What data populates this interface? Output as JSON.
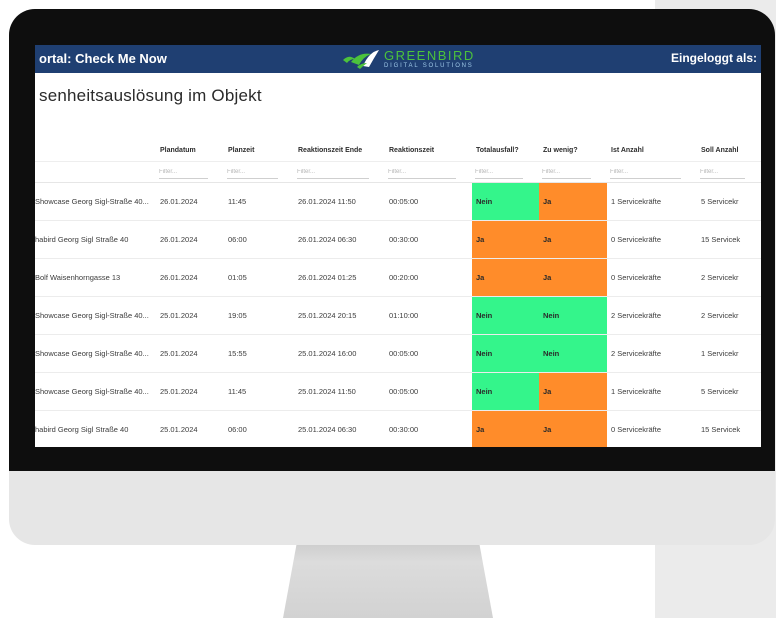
{
  "colors": {
    "appbar_bg": "#1f3f72",
    "status_yes": "#ff8c2a",
    "status_no": "#34f58b",
    "logo_green": "#4cc23c"
  },
  "appbar": {
    "title": "ortal: Check Me Now",
    "logo_line1": "GREENBIRD",
    "logo_line2": "DIGITAL SOLUTIONS",
    "logo_icon": "greenbird-logo-icon",
    "user": "Eingeloggt als:"
  },
  "page": {
    "title": "senheitsauslösung im Objekt"
  },
  "table": {
    "headers": [
      "",
      "Plandatum",
      "Planzeit",
      "Reaktionszeit Ende",
      "Reaktionszeit",
      "Totalausfall?",
      "Zu wenig?",
      "Ist Anzahl",
      "Soll Anzahl"
    ],
    "filter_placeholder": "Filter...",
    "rows": [
      [
        "Showcase Georg Sigl-Straße 40...",
        "26.01.2024",
        "11:45",
        "26.01.2024 11:50",
        "00:05:00",
        "Nein",
        "Ja",
        "1 Servicekräfte",
        "5 Servicekr"
      ],
      [
        "habird Georg Sigl Straße 40",
        "26.01.2024",
        "06:00",
        "26.01.2024 06:30",
        "00:30:00",
        "Ja",
        "Ja",
        "0 Servicekräfte",
        "15 Servicek"
      ],
      [
        "Bolf Waisenhorngasse 13",
        "26.01.2024",
        "01:05",
        "26.01.2024 01:25",
        "00:20:00",
        "Ja",
        "Ja",
        "0 Servicekräfte",
        "2 Servicekr"
      ],
      [
        "Showcase Georg Sigl-Straße 40...",
        "25.01.2024",
        "19:05",
        "25.01.2024 20:15",
        "01:10:00",
        "Nein",
        "Nein",
        "2 Servicekräfte",
        "2 Servicekr"
      ],
      [
        "Showcase Georg Sigl-Straße 40...",
        "25.01.2024",
        "15:55",
        "25.01.2024 16:00",
        "00:05:00",
        "Nein",
        "Nein",
        "2 Servicekräfte",
        "1 Servicekr"
      ],
      [
        "Showcase Georg Sigl-Straße 40...",
        "25.01.2024",
        "11:45",
        "25.01.2024 11:50",
        "00:05:00",
        "Nein",
        "Ja",
        "1 Servicekräfte",
        "5 Servicekr"
      ],
      [
        "habird Georg Sigl Straße 40",
        "25.01.2024",
        "06:00",
        "25.01.2024 06:30",
        "00:30:00",
        "Ja",
        "Ja",
        "0 Servicekräfte",
        "15 Servicek"
      ]
    ]
  }
}
